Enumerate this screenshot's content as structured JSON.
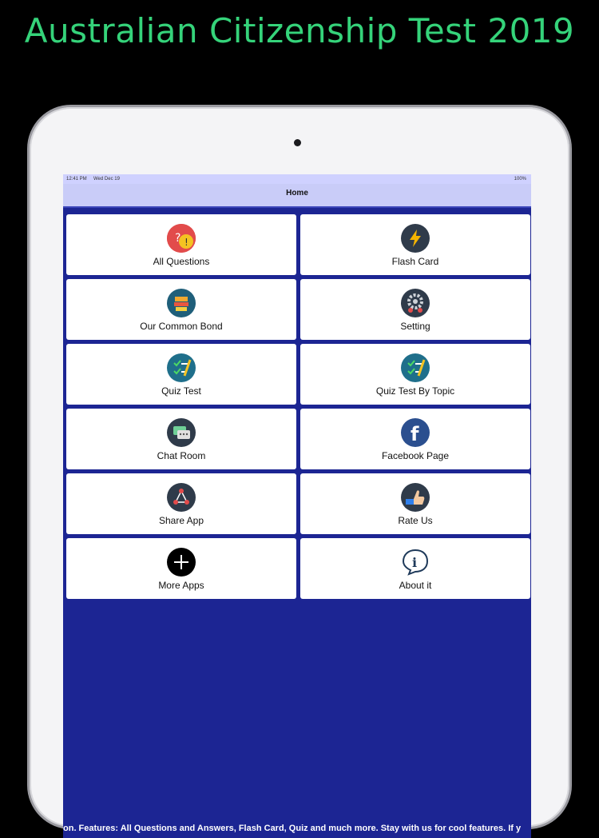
{
  "promo": {
    "title": "Australian Citizenship Test 2019"
  },
  "statusbar": {
    "time": "12:41 PM",
    "date": "Wed Dec 19",
    "battery": "100%"
  },
  "navbar": {
    "title": "Home"
  },
  "menu": [
    {
      "label": "All Questions",
      "icon": "question-icon",
      "color": "#c0392b"
    },
    {
      "label": "Flash Card",
      "icon": "lightning-icon",
      "color": "#2f3b4a"
    },
    {
      "label": "Our Common Bond",
      "icon": "book-icon",
      "color": "#1f5f7a"
    },
    {
      "label": "Setting",
      "icon": "gear-icon",
      "color": "#2f3b4a"
    },
    {
      "label": "Quiz Test",
      "icon": "checklist-icon",
      "color": "#1f6f8b"
    },
    {
      "label": "Quiz Test By Topic",
      "icon": "checklist-icon",
      "color": "#1f6f8b"
    },
    {
      "label": "Chat Room",
      "icon": "chat-icon",
      "color": "#2f3b4a"
    },
    {
      "label": "Facebook Page",
      "icon": "facebook-icon",
      "color": "#2b4f8f"
    },
    {
      "label": "Share App",
      "icon": "share-icon",
      "color": "#2f3b4a"
    },
    {
      "label": "Rate Us",
      "icon": "thumbs-up-icon",
      "color": "#2f3b4a"
    },
    {
      "label": "More Apps",
      "icon": "plus-icon",
      "color": "#000000"
    },
    {
      "label": "About it",
      "icon": "info-icon",
      "color": "#ffffff"
    }
  ],
  "ticker": {
    "text": "on. Features: All Questions and Answers, Flash Card, Quiz and much more. Stay with us for cool features. If y"
  }
}
